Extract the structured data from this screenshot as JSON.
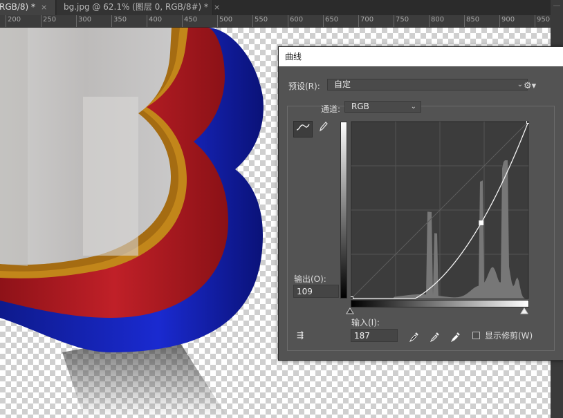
{
  "tabs": [
    {
      "label": "RGB/8) *",
      "close": "×"
    },
    {
      "label": "bg.jpg @ 62.1% (图层 0, RGB/8#) *",
      "close": "×"
    }
  ],
  "ruler": {
    "ticks": [
      "200",
      "250",
      "300",
      "350",
      "400",
      "450",
      "500",
      "550",
      "600",
      "650",
      "700",
      "750",
      "800",
      "850",
      "900",
      "950"
    ]
  },
  "dialog": {
    "title": "曲线",
    "preset_label": "预设(R):",
    "preset_value": "自定",
    "channel_label": "通道:",
    "channel_value": "RGB",
    "output_label": "输出(O):",
    "output_value": "109",
    "input_label": "输入(I):",
    "input_value": "187",
    "show_clipping_label": "显示修剪(W)",
    "show_clipping_checked": false
  },
  "curve": {
    "points": [
      [
        0,
        0
      ],
      [
        187,
        109
      ],
      [
        255,
        255
      ]
    ],
    "selected_point": [
      187,
      109
    ]
  },
  "colors": {
    "red": "#b01c22",
    "blue": "#1223b8",
    "gold": "#c88a1a",
    "dialog_bg": "#535353"
  }
}
